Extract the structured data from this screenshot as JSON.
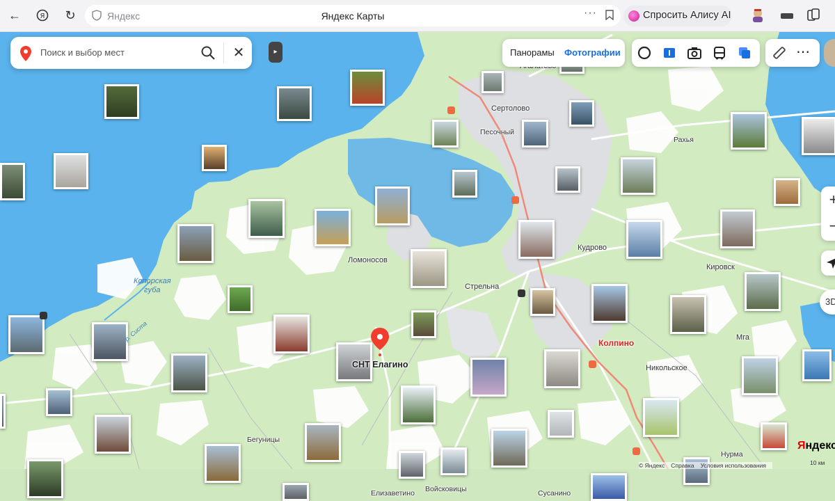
{
  "browser": {
    "address_host": "Яндекс",
    "page_title": "Яндекс Карты",
    "alice_label": "Спросить Алису AI"
  },
  "search": {
    "placeholder": "Поиск и выбор мест"
  },
  "layers": {
    "panoramas": "Панорамы",
    "photos": "Фотографии",
    "active": "photos"
  },
  "controls": {
    "zoom_in": "+",
    "zoom_out": "−",
    "mode_3d": "3D"
  },
  "place_marker": {
    "label": "СНТ Елагино"
  },
  "labels": {
    "agalatovo": "Агалатово",
    "sertolovo": "Сертолово",
    "pesochny": "Песочный",
    "rakhya": "Рахья",
    "kudrovo": "Кудрово",
    "kirovsk": "Кировск",
    "lomonosov": "Ломоносов",
    "strelna": "Стрельна",
    "koporskaya": "Копорская\nгуба",
    "kolpino": "Колпино",
    "mga": "Мга",
    "nikolskoe": "Никольское",
    "begunitsy": "Бегуницы",
    "nurma": "Нурма",
    "elizavetino": "Елизаветино",
    "voiskovitsy": "Войсковицы",
    "susanino": "Сусанино",
    "river_sista": "р. Систа"
  },
  "attribution": {
    "copyright": "© Яндекс",
    "help": "Справка",
    "terms": "Условия использования",
    "logo_ya": "Я",
    "logo_rest": "ндекс",
    "scale": "10 км"
  },
  "colors": {
    "water": "#5ab3ec",
    "land": "#d2ebc1",
    "forest": "#ffffff",
    "city": "#dddfe3",
    "railway": "#ef8a78",
    "accent_blue": "#1a6fe0",
    "marker_red": "#f03d2e"
  }
}
